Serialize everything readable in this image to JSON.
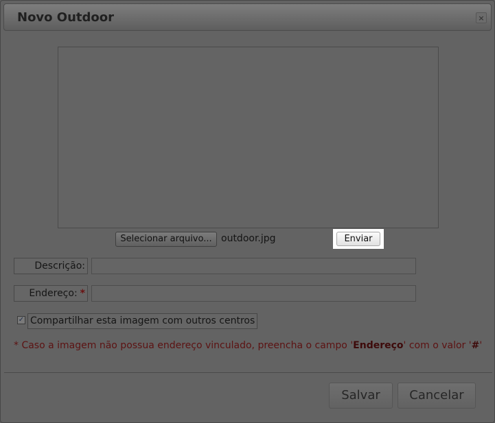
{
  "dialog": {
    "title": "Novo Outdoor",
    "close_label": "×"
  },
  "upload": {
    "select_label": "Selecionar arquivo...",
    "file_name": "outdoor.jpg",
    "send_label": "Enviar"
  },
  "form": {
    "description_label": "Descrição:",
    "address_label": "Endereço:",
    "required_mark": "*",
    "share_checked": true,
    "check_mark": "✓",
    "share_label": "Compartilhar esta imagem com outros centros"
  },
  "note": {
    "prefix": "* Caso a imagem não possua endereço vinculado, preencha o campo '",
    "field": "Endereço",
    "middle": "' com o valor '",
    "value": "#",
    "suffix": "'"
  },
  "footer": {
    "save_label": "Salvar",
    "cancel_label": "Cancelar"
  }
}
